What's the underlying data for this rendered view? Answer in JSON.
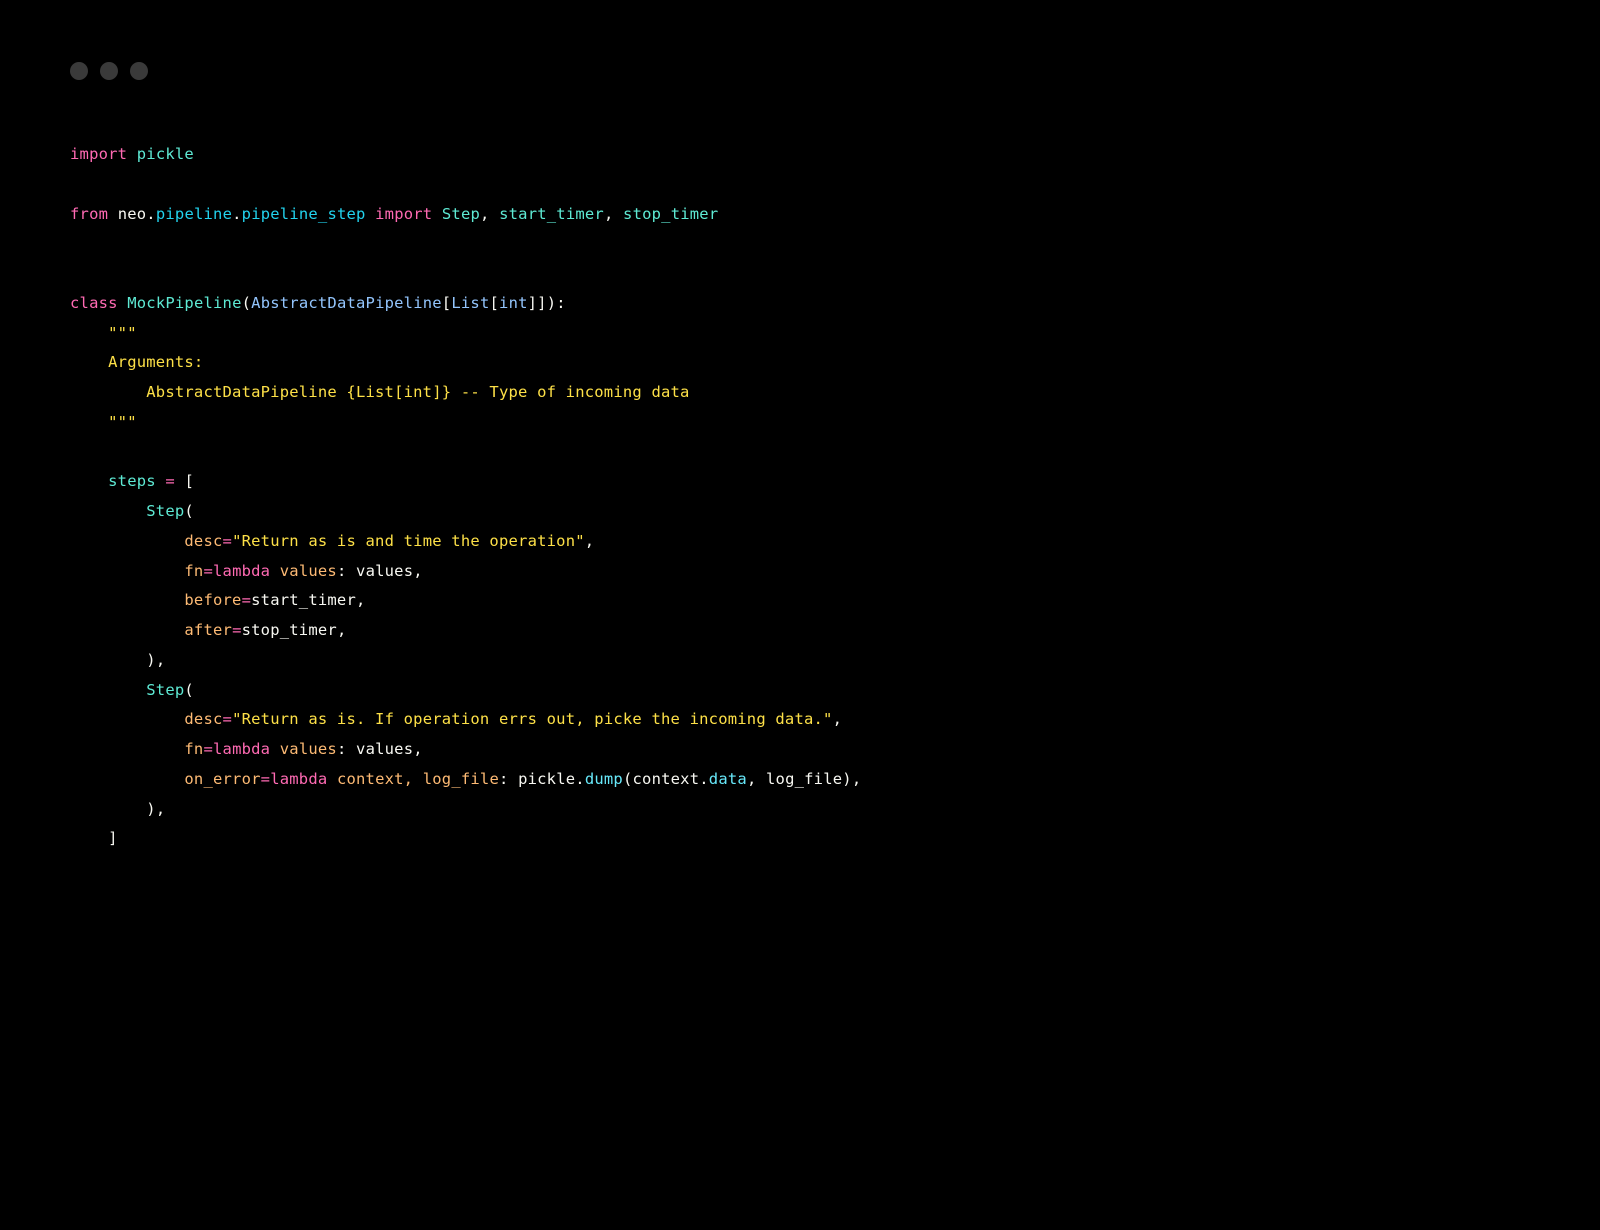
{
  "code": {
    "line1": {
      "import_kw": "import",
      "module": "pickle"
    },
    "line2": {
      "from_kw": "from",
      "ns1": "neo",
      "ns2": "pipeline",
      "ns3": "pipeline_step",
      "import_kw": "import",
      "name1": "Step",
      "name2": "start_timer",
      "name3": "stop_timer"
    },
    "classdef": {
      "class_kw": "class",
      "name": "MockPipeline",
      "base": "AbstractDataPipeline",
      "listtype": "List",
      "inttype": "int"
    },
    "docstring": {
      "openq": "\"\"\"",
      "arguments_label": "Arguments:",
      "argline": "AbstractDataPipeline {List[int]} -- Type of incoming data",
      "closeq": "\"\"\""
    },
    "steps_var": "steps",
    "stepcall": "Step",
    "step1": {
      "desc_key": "desc",
      "desc_val": "\"Return as is and time the operation\"",
      "fn_key": "fn",
      "lambda_kw": "lambda",
      "lambda_arg": "values",
      "lambda_body": "values",
      "before_key": "before",
      "before_val": "start_timer",
      "after_key": "after",
      "after_val": "stop_timer"
    },
    "step2": {
      "desc_key": "desc",
      "desc_val": "\"Return as is. If operation errs out, picke the incoming data.\"",
      "fn_key": "fn",
      "lambda_kw": "lambda",
      "lambda_arg": "values",
      "lambda_body": "values",
      "onerror_key": "on_error",
      "onerror_lambda_kw": "lambda",
      "onerror_args": "context, log_file",
      "pickle_mod": "pickle",
      "dump_fn": "dump",
      "ctx": "context",
      "data_attr": "data",
      "logfile": "log_file"
    }
  }
}
